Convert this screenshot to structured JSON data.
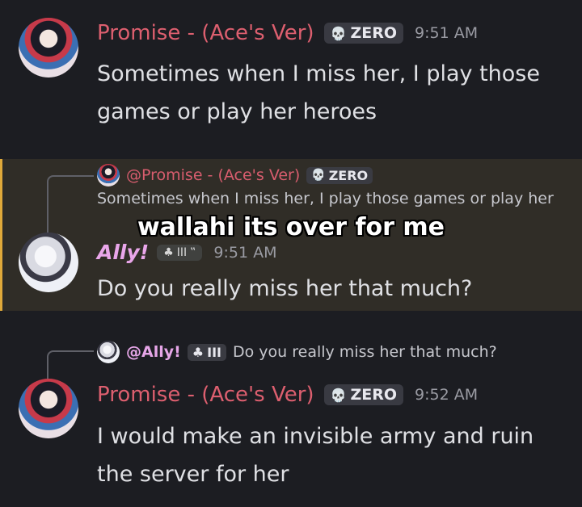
{
  "messages": [
    {
      "username": "Promise - (Ace's Ver)",
      "tag": "ZERO",
      "tag_icon": "skull-icon",
      "time": "9:51 AM",
      "content": "Sometimes when I miss her, I play those games or play her heroes"
    },
    {
      "reply_to": {
        "username": "@Promise - (Ace's Ver)",
        "tag": "ZERO",
        "excerpt": "Sometimes when I miss her, I play those games or play her"
      },
      "username": "Ally!",
      "badge_text": "III",
      "badge_icons": [
        "sprout-icon",
        "sparkle-icon"
      ],
      "time": "9:51 AM",
      "content": "Do you really miss her that much?"
    },
    {
      "reply_to": {
        "username": "@Ally!",
        "badge_text": "III",
        "excerpt": "Do you really miss her that much?"
      },
      "username": "Promise - (Ace's Ver)",
      "tag": "ZERO",
      "tag_icon": "skull-icon",
      "time": "9:52 AM",
      "content": "I would make an invisible army and ruin the server for her"
    }
  ],
  "caption": "wallahi its over for me",
  "colors": {
    "background": "#1c1d22",
    "highlight_bg": "#302d27",
    "highlight_bar": "#e0a93a",
    "promise_name": "#dd5f6f",
    "ally_name": "#e9a6ea",
    "text": "#dfe0e4",
    "muted": "#9a9ba3"
  }
}
